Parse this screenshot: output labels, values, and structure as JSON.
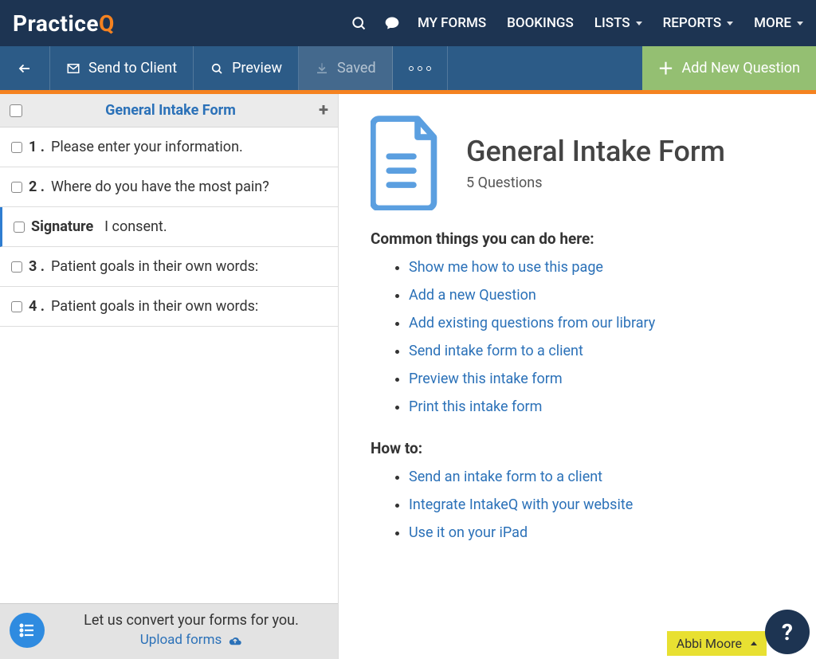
{
  "brand": {
    "practice": "Practice",
    "q": "Q"
  },
  "topnav": {
    "myforms": "MY FORMS",
    "bookings": "BOOKINGS",
    "lists": "LISTS",
    "reports": "REPORTS",
    "more": "MORE"
  },
  "toolbar": {
    "send": "Send to Client",
    "preview": "Preview",
    "saved": "Saved",
    "add": "Add New Question"
  },
  "form": {
    "title": "General Intake Form",
    "count_label": "5 Questions",
    "questions": [
      {
        "num": "1",
        "text": "Please enter your information.",
        "signature": false
      },
      {
        "num": "2",
        "text": "Where do you have the most pain?",
        "signature": false
      },
      {
        "num": "",
        "text": "I consent.",
        "signature": true
      },
      {
        "num": "3",
        "text": "Patient goals in their own words:",
        "signature": false
      },
      {
        "num": "4",
        "text": "Patient goals in their own words:",
        "signature": false
      }
    ],
    "signature_label": "Signature"
  },
  "common": {
    "heading": "Common things you can do here:",
    "links": [
      "Show me how to use this page",
      "Add a new Question",
      "Add existing questions from our library",
      "Send intake form to a client",
      "Preview this intake form",
      "Print this intake form"
    ]
  },
  "howto": {
    "heading": "How to:",
    "links": [
      "Send an intake form to a client",
      "Integrate IntakeQ with your website",
      "Use it on your iPad"
    ]
  },
  "convert": {
    "line1": "Let us convert your forms for you.",
    "upload": "Upload forms"
  },
  "user": {
    "name": "Abbi Moore"
  }
}
